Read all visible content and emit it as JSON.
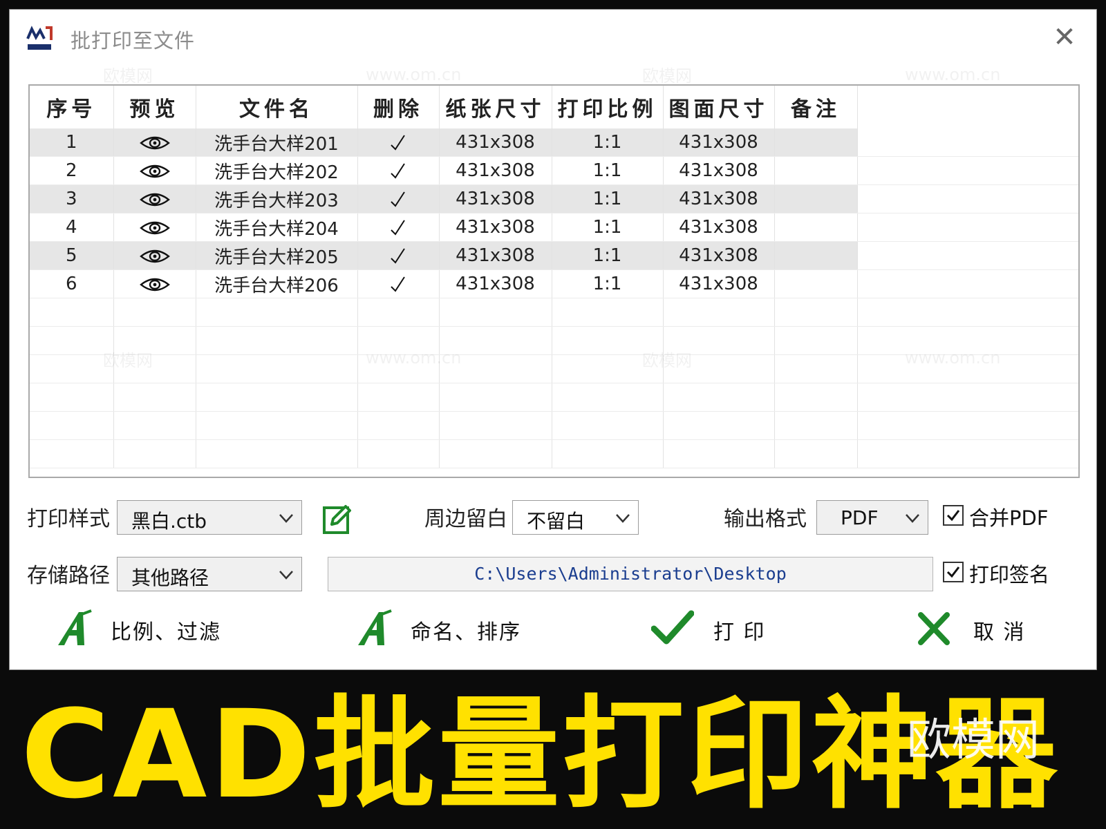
{
  "window": {
    "title": "批打印至文件",
    "close_glyph": "✕",
    "logo_icon": "bitool-logo-icon"
  },
  "table": {
    "headers": [
      "序号",
      "预览",
      "文件名",
      "删除",
      "纸张尺寸",
      "打印比例",
      "图面尺寸",
      "备注"
    ],
    "rows": [
      {
        "index": "1",
        "preview_icon": "eye-icon",
        "filename": "洗手台大样201",
        "delete_icon": "check-icon",
        "paper_size": "431x308",
        "scale": "1:1",
        "drawing_size": "431x308",
        "remark": ""
      },
      {
        "index": "2",
        "preview_icon": "eye-icon",
        "filename": "洗手台大样202",
        "delete_icon": "check-icon",
        "paper_size": "431x308",
        "scale": "1:1",
        "drawing_size": "431x308",
        "remark": ""
      },
      {
        "index": "3",
        "preview_icon": "eye-icon",
        "filename": "洗手台大样203",
        "delete_icon": "check-icon",
        "paper_size": "431x308",
        "scale": "1:1",
        "drawing_size": "431x308",
        "remark": ""
      },
      {
        "index": "4",
        "preview_icon": "eye-icon",
        "filename": "洗手台大样204",
        "delete_icon": "check-icon",
        "paper_size": "431x308",
        "scale": "1:1",
        "drawing_size": "431x308",
        "remark": ""
      },
      {
        "index": "5",
        "preview_icon": "eye-icon",
        "filename": "洗手台大样205",
        "delete_icon": "check-icon",
        "paper_size": "431x308",
        "scale": "1:1",
        "drawing_size": "431x308",
        "remark": ""
      },
      {
        "index": "6",
        "preview_icon": "eye-icon",
        "filename": "洗手台大样206",
        "delete_icon": "check-icon",
        "paper_size": "431x308",
        "scale": "1:1",
        "drawing_size": "431x308",
        "remark": ""
      }
    ]
  },
  "options": {
    "print_style": {
      "label": "打印样式",
      "value": "黑白.ctb"
    },
    "margin": {
      "label": "周边留白",
      "value": "不留白"
    },
    "output_format": {
      "label": "输出格式",
      "value": "PDF"
    },
    "merge_pdf": {
      "label": "合并PDF",
      "checked": true
    },
    "save_path": {
      "label": "存储路径",
      "value": "其他路径",
      "path": "C:\\Users\\Administrator\\Desktop"
    },
    "print_signature": {
      "label": "打印签名",
      "checked": true
    }
  },
  "actions": {
    "scale_filter": "比例、过滤",
    "rename_sort": "命名、排序",
    "print": "打 印",
    "cancel": "取 消"
  },
  "banner": {
    "text": "CAD批量打印神器",
    "watermark": "欧模网"
  },
  "watermarks": {
    "brand": "欧模网",
    "url": "www.om.cn"
  },
  "colors": {
    "accent_green": "#1f8a2b",
    "banner_yellow": "#ffe100",
    "path_blue": "#1a3d8f",
    "row_stripe": "#e6e6e6"
  }
}
